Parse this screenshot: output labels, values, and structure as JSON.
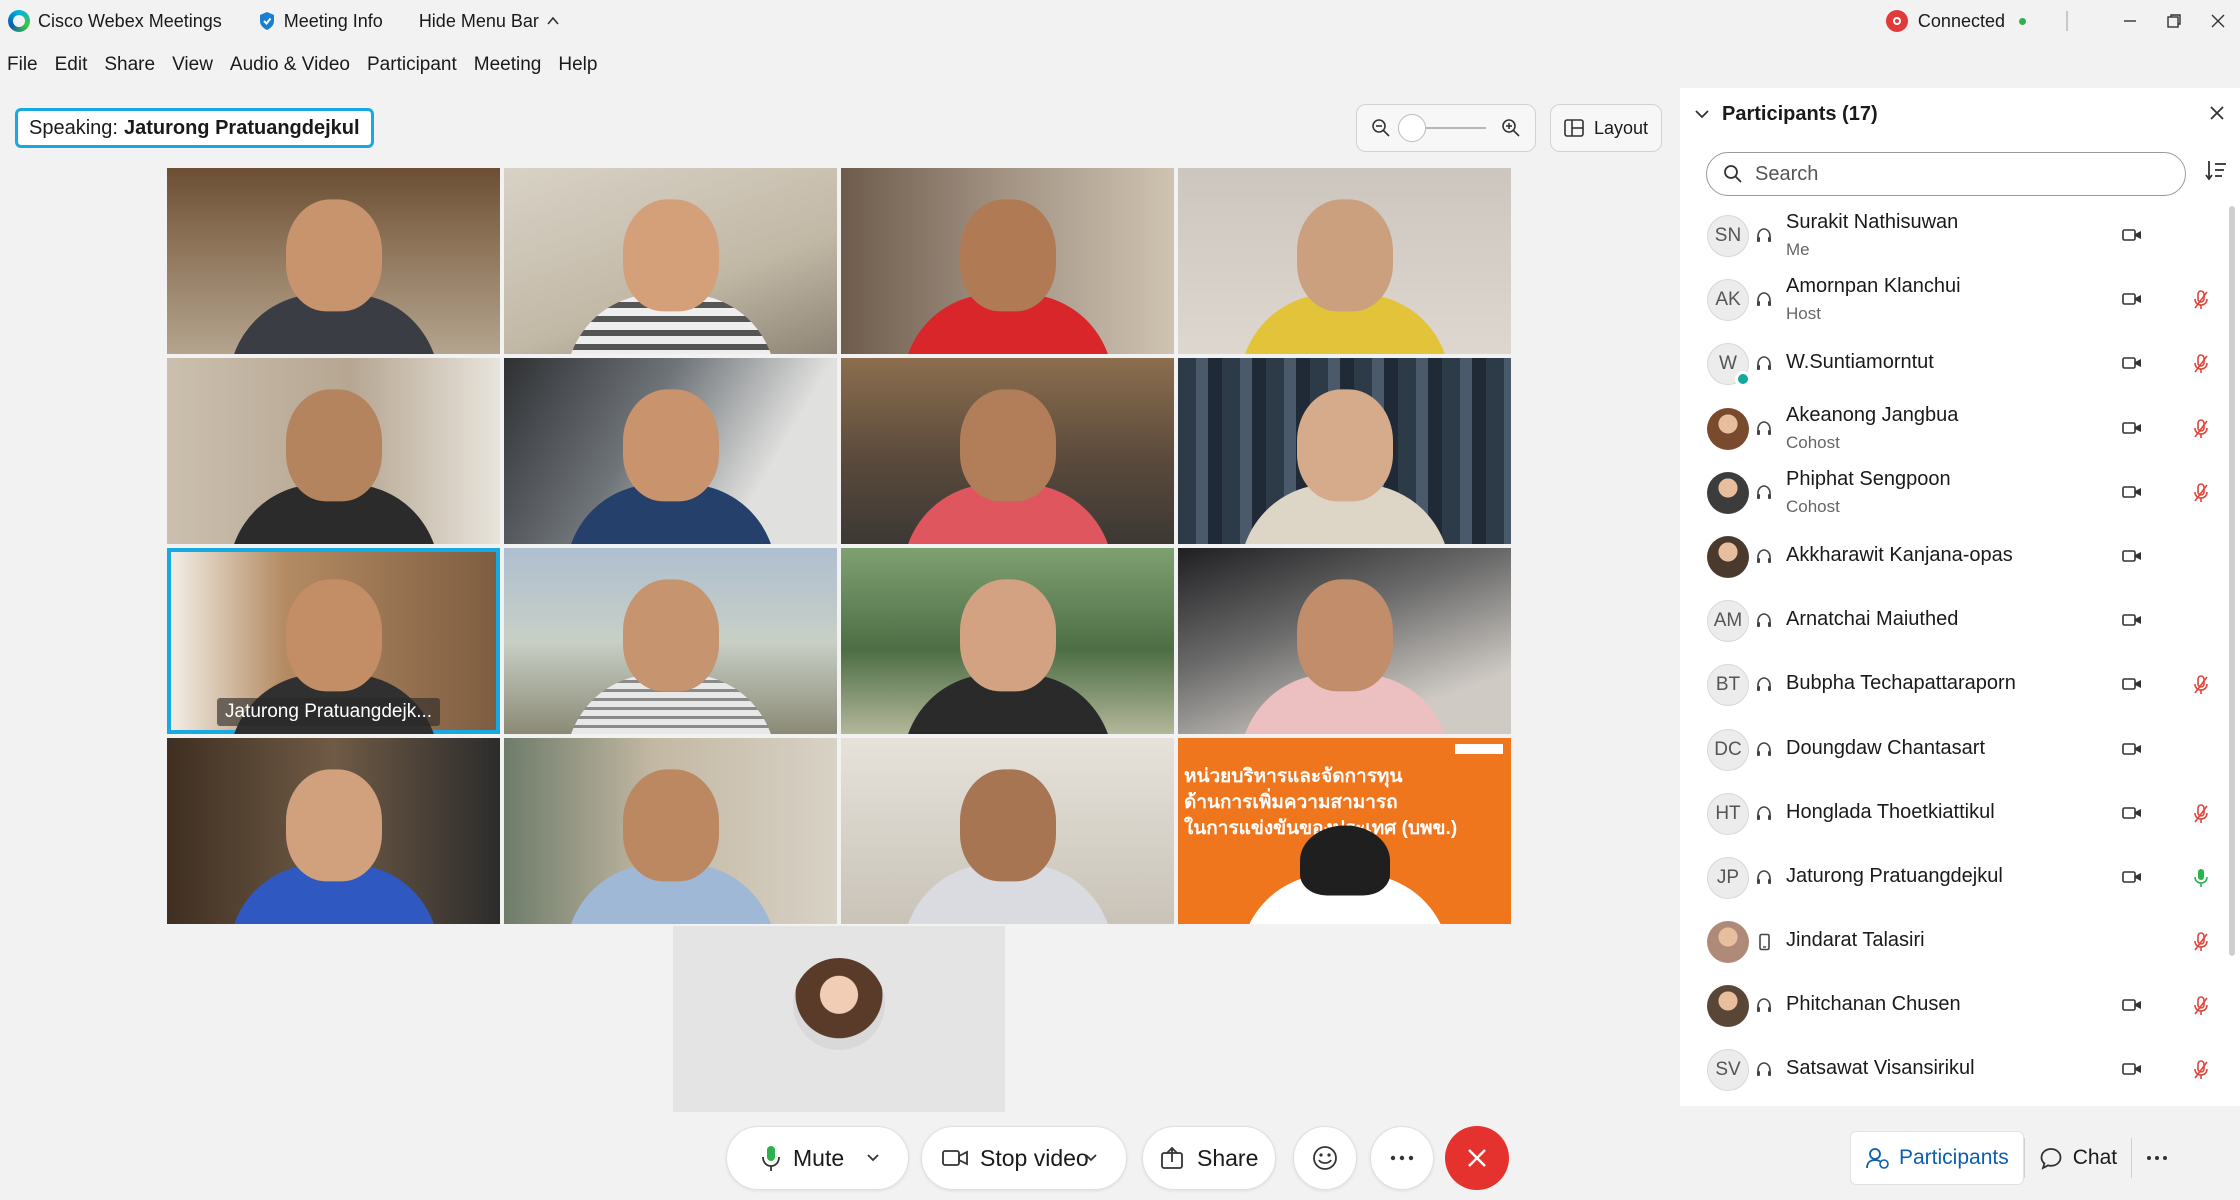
{
  "titlebar": {
    "app_name": "Cisco Webex Meetings",
    "meeting_info": "Meeting Info",
    "hide_menu": "Hide Menu Bar",
    "connection_status": "Connected"
  },
  "menu": [
    "File",
    "Edit",
    "Share",
    "View",
    "Audio & Video",
    "Participant",
    "Meeting",
    "Help"
  ],
  "speaking": {
    "prefix": "Speaking:",
    "name": "Jaturong Pratuangdejkul"
  },
  "layout_label": "Layout",
  "zoom_level": 0.1,
  "active_tile_label": "Jaturong Pratuangdejk...",
  "slide_text": [
    "หน่วยบริหารและจัดการทุน",
    "ด้านการเพิ่มความสามารถ",
    "ในการแข่งขันของประเทศ (บพข.)"
  ],
  "controls": {
    "mute": "Mute",
    "stop_video": "Stop video",
    "share": "Share"
  },
  "panel": {
    "title": "Participants (17)",
    "search_placeholder": "Search",
    "participants": [
      {
        "initials": "SN",
        "name": "Surakit Nathisuwan",
        "role": "Me",
        "device": "headset",
        "camera": true,
        "mic": "none"
      },
      {
        "initials": "AK",
        "name": "Amornpan Klanchui",
        "role": "Host",
        "device": "headset",
        "camera": true,
        "mic": "muted"
      },
      {
        "initials": "W",
        "name": "W.Suntiamorntut",
        "role": "",
        "device": "headset",
        "camera": true,
        "mic": "muted",
        "presence": true
      },
      {
        "initials": "",
        "name": "Akeanong Jangbua",
        "role": "Cohost",
        "device": "headset",
        "camera": true,
        "mic": "muted",
        "photo": "#7a4a2e"
      },
      {
        "initials": "",
        "name": "Phiphat Sengpoon",
        "role": "Cohost",
        "device": "headset",
        "camera": true,
        "mic": "muted",
        "photo": "#3c3c3c"
      },
      {
        "initials": "",
        "name": "Akkharawit Kanjana-opas",
        "role": "",
        "device": "headset",
        "camera": true,
        "mic": "none",
        "photo": "#4a3a2e"
      },
      {
        "initials": "AM",
        "name": "Arnatchai Maiuthed",
        "role": "",
        "device": "headset",
        "camera": true,
        "mic": "none"
      },
      {
        "initials": "BT",
        "name": "Bubpha Techapattaraporn",
        "role": "",
        "device": "headset",
        "camera": true,
        "mic": "muted"
      },
      {
        "initials": "DC",
        "name": "Doungdaw Chantasart",
        "role": "",
        "device": "headset",
        "camera": true,
        "mic": "none"
      },
      {
        "initials": "HT",
        "name": "Honglada Thoetkiattikul",
        "role": "",
        "device": "headset",
        "camera": true,
        "mic": "muted"
      },
      {
        "initials": "JP",
        "name": "Jaturong Pratuangdejkul",
        "role": "",
        "device": "headset",
        "camera": true,
        "mic": "active"
      },
      {
        "initials": "",
        "name": "Jindarat Talasiri",
        "role": "",
        "device": "phone",
        "camera": false,
        "mic": "muted",
        "photo": "#b08a78"
      },
      {
        "initials": "",
        "name": "Phitchanan Chusen",
        "role": "",
        "device": "headset",
        "camera": true,
        "mic": "muted",
        "photo": "#5a4636"
      },
      {
        "initials": "SV",
        "name": "Satsawat Visansirikul",
        "role": "",
        "device": "headset",
        "camera": true,
        "mic": "muted"
      }
    ]
  },
  "tabs": {
    "participants": "Participants",
    "chat": "Chat"
  },
  "colors": {
    "accent": "#17a9e1",
    "end_call": "#e6322f",
    "slide": "#f0761e",
    "link": "#0a5fb0"
  }
}
